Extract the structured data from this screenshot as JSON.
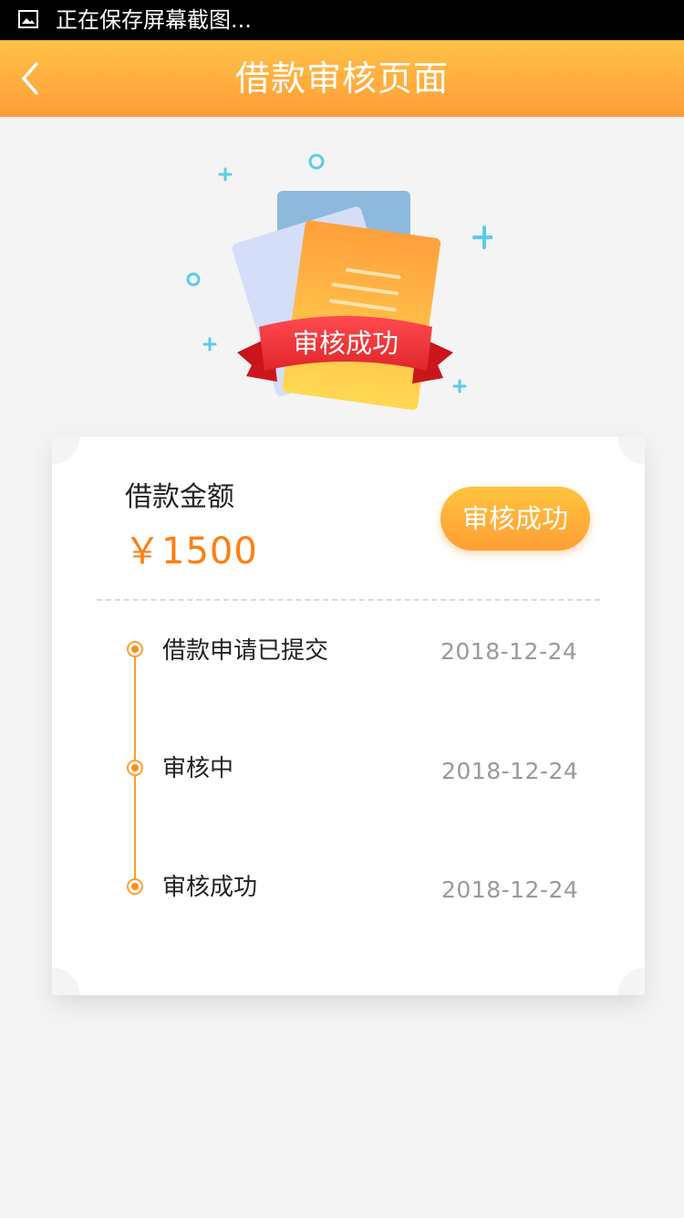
{
  "status_bar": {
    "icon": "image-icon",
    "text": "正在保存屏幕截图..."
  },
  "nav": {
    "back_icon": "chevron-left-icon",
    "title": "借款审核页面"
  },
  "illustration": {
    "ribbon_text": "审核成功"
  },
  "card": {
    "amount_label": "借款金额",
    "amount_value": "￥1500",
    "status_button": "审核成功"
  },
  "timeline": [
    {
      "label": "借款申请已提交",
      "date": "2018-12-24"
    },
    {
      "label": "审核中",
      "date": "2018-12-24"
    },
    {
      "label": "审核成功",
      "date": "2018-12-24"
    }
  ],
  "colors": {
    "accent": "#ff9d38",
    "amount": "#ff7d12",
    "timeline": "#ff9d30",
    "ribbon": "#e0262b"
  }
}
